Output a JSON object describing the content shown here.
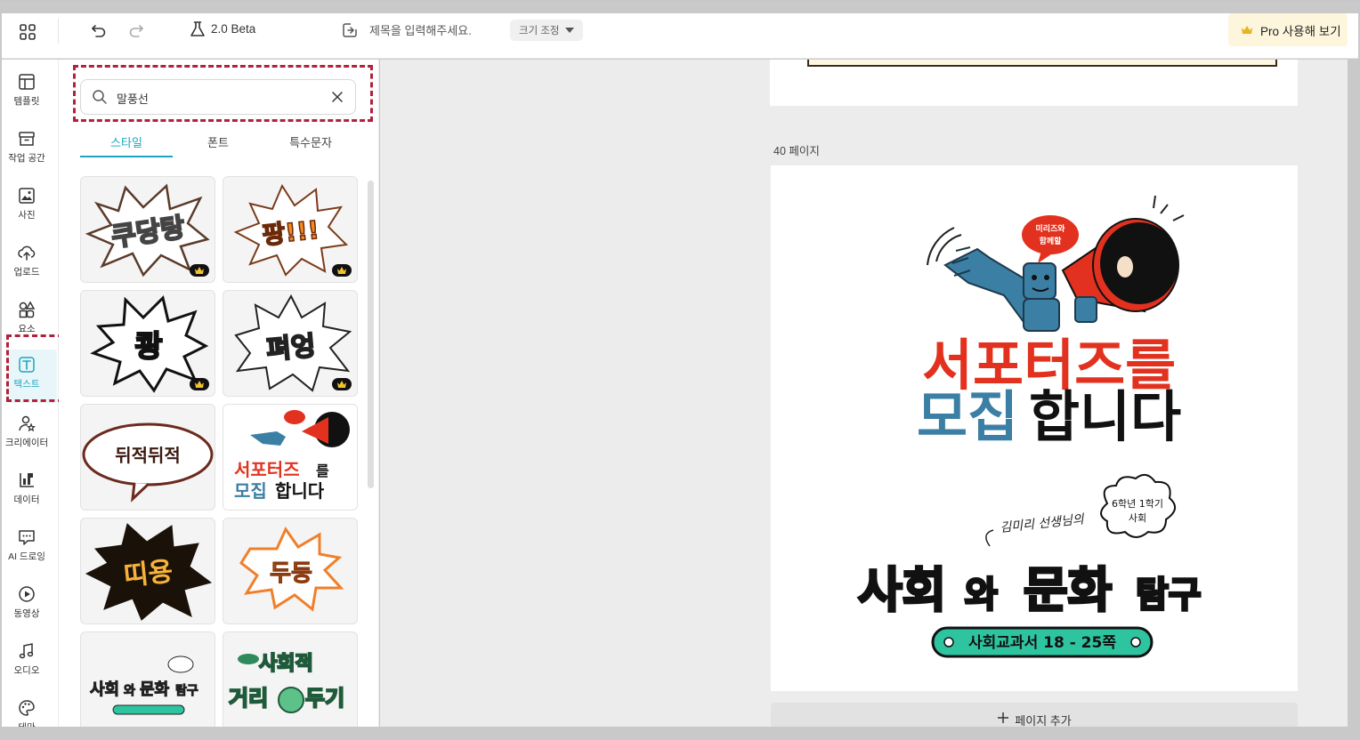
{
  "topbar": {
    "version": "2.0 Beta",
    "title_placeholder": "제목을 입력해주세요.",
    "resize_label": "크기 조정",
    "pro_label": "Pro 사용해 보기"
  },
  "rail": {
    "items": [
      {
        "label": "템플릿",
        "icon": "template-icon"
      },
      {
        "label": "작업 공간",
        "icon": "archive-icon"
      },
      {
        "label": "사진",
        "icon": "photo-icon"
      },
      {
        "label": "업로드",
        "icon": "upload-icon"
      },
      {
        "label": "요소",
        "icon": "elements-icon"
      },
      {
        "label": "텍스트",
        "icon": "text-icon"
      },
      {
        "label": "크리에이터",
        "icon": "creator-icon"
      },
      {
        "label": "데이터",
        "icon": "chart-icon"
      },
      {
        "label": "AI 드로잉",
        "icon": "ai-drawing-icon"
      },
      {
        "label": "동영상",
        "icon": "video-icon"
      },
      {
        "label": "오디오",
        "icon": "audio-icon"
      },
      {
        "label": "테마",
        "icon": "palette-icon"
      }
    ],
    "active": "텍스트"
  },
  "panel": {
    "search_value": "말풍선",
    "tabs": [
      "스타일",
      "폰트",
      "특수문자"
    ],
    "active_tab": "스타일",
    "cards": [
      {
        "text": "쿠당탕",
        "pro": true
      },
      {
        "text": "팡!!!",
        "pro": true
      },
      {
        "text": "쾅",
        "pro": true
      },
      {
        "text": "펴엉",
        "pro": true
      },
      {
        "text": "뒤적뒤적",
        "pro": false
      },
      {
        "text": "서포터즈를 모집합니다",
        "pro": false
      },
      {
        "text": "띠용",
        "pro": false
      },
      {
        "text": "두둥",
        "pro": false
      },
      {
        "text": "사회와 문화탐구",
        "pro": false
      },
      {
        "text": "사회적 거리두기",
        "pro": false
      }
    ]
  },
  "canvas": {
    "page_label": "40 페이지",
    "add_page_label": "페이지 추가",
    "headline_line1": "서포터즈를",
    "headline_line2_a": "모집",
    "headline_line2_b": "합니다",
    "bubble_small": "미리즈와\n함께할",
    "teacher_line": "김미리 선생님의",
    "grade_bubble_1": "6학년 1학기",
    "grade_bubble_2": "사회",
    "subject_a": "사회",
    "subject_b": "와",
    "subject_c": "문화",
    "subject_d": "탐구",
    "pill_text": "사회교과서 18 - 25쪽"
  },
  "colors": {
    "accent": "#1aa5c4",
    "dash": "#b1213b",
    "red": "#e2321f",
    "blue": "#3c7fa4",
    "teal": "#2ec4a0",
    "yellow": "#fde55a",
    "salmon": "#f7a08c"
  }
}
